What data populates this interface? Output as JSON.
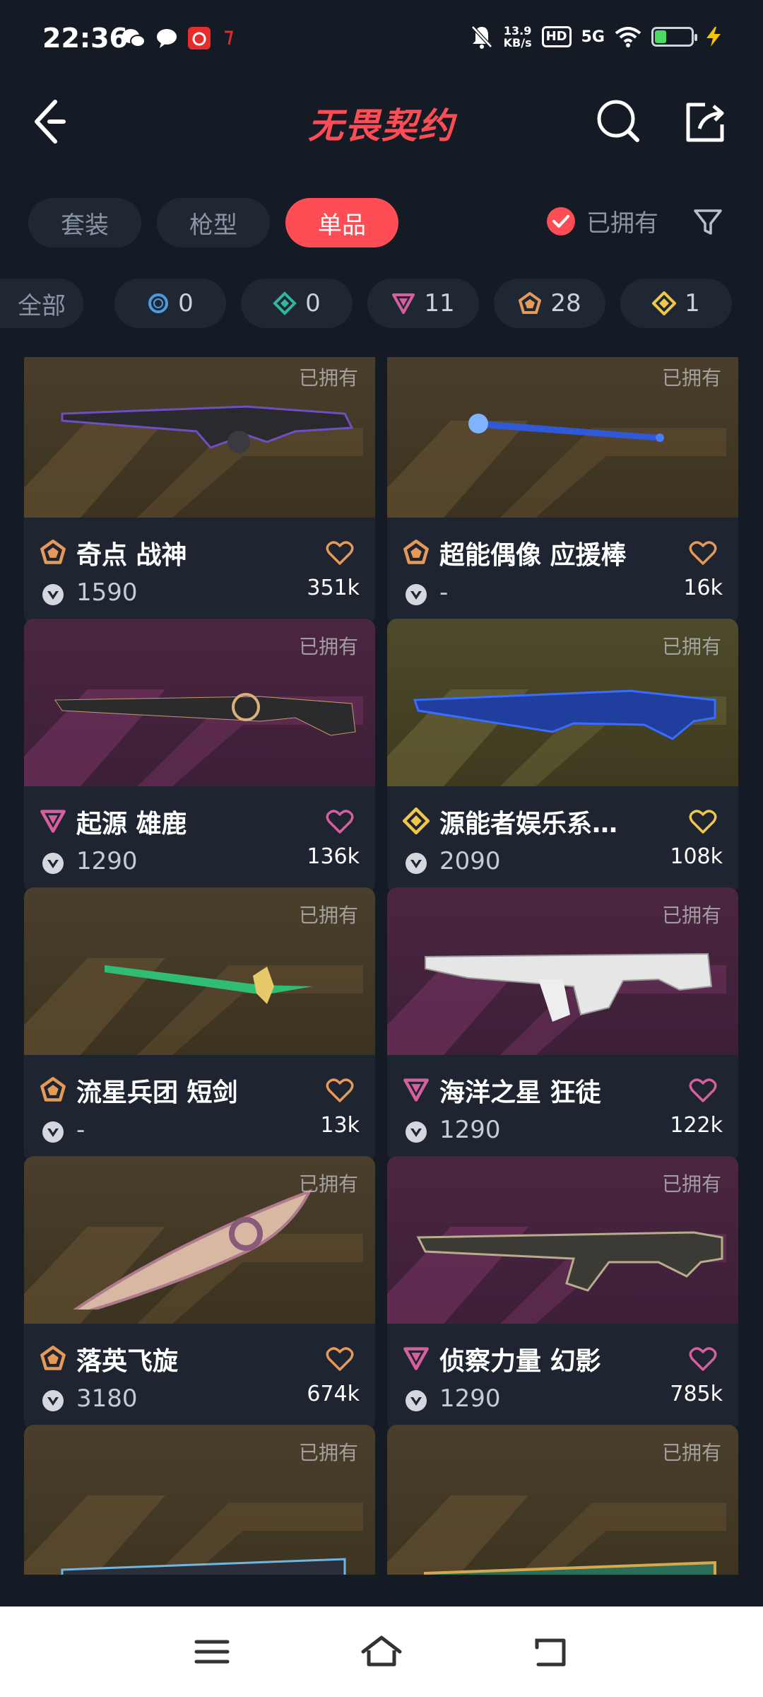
{
  "status_bar": {
    "time": "22:36",
    "net_speed_value": "13.9",
    "net_speed_unit": "KB/s",
    "hd": "HD",
    "network": "5G",
    "battery_level": 0.3
  },
  "header": {
    "logo": "无畏契约"
  },
  "tabs": [
    {
      "label": "套装",
      "active": false
    },
    {
      "label": "枪型",
      "active": false
    },
    {
      "label": "单品",
      "active": true
    }
  ],
  "owned_filter": {
    "label": "已拥有",
    "checked": true
  },
  "chips": [
    {
      "label": "全部",
      "count": ""
    },
    {
      "label": "",
      "count": "0",
      "icon": "select-tier-icon"
    },
    {
      "label": "",
      "count": "0",
      "icon": "deluxe-tier-icon"
    },
    {
      "label": "",
      "count": "11",
      "icon": "premium-tier-icon"
    },
    {
      "label": "",
      "count": "28",
      "icon": "exclusive-tier-icon"
    },
    {
      "label": "",
      "count": "1",
      "icon": "ultra-tier-icon"
    }
  ],
  "items": [
    {
      "name": "奇点 战神",
      "price": "1590",
      "likes": "351k",
      "owned": "已拥有",
      "tier": "exclusive",
      "bg": "gold"
    },
    {
      "name": "超能偶像 应援棒",
      "price": "-",
      "likes": "16k",
      "owned": "已拥有",
      "tier": "exclusive",
      "bg": "gold"
    },
    {
      "name": "起源 雄鹿",
      "price": "1290",
      "likes": "136k",
      "owned": "已拥有",
      "tier": "premium",
      "bg": "purple"
    },
    {
      "name": "源能者娱乐系…",
      "price": "2090",
      "likes": "108k",
      "owned": "已拥有",
      "tier": "ultra",
      "bg": "yellow"
    },
    {
      "name": "流星兵团 短剑",
      "price": "-",
      "likes": "13k",
      "owned": "已拥有",
      "tier": "exclusive",
      "bg": "gold"
    },
    {
      "name": "海洋之星 狂徒",
      "price": "1290",
      "likes": "122k",
      "owned": "已拥有",
      "tier": "premium",
      "bg": "purple"
    },
    {
      "name": "落英飞旋",
      "price": "3180",
      "likes": "674k",
      "owned": "已拥有",
      "tier": "exclusive",
      "bg": "gold"
    },
    {
      "name": "侦察力量 幻影",
      "price": "1290",
      "likes": "785k",
      "owned": "已拥有",
      "tier": "premium",
      "bg": "purple"
    },
    {
      "name": "",
      "price": "",
      "likes": "",
      "owned": "已拥有",
      "tier": "",
      "bg": "gold"
    },
    {
      "name": "",
      "price": "",
      "likes": "",
      "owned": "已拥有",
      "tier": "",
      "bg": "gold"
    }
  ],
  "colors": {
    "accent": "#ff4d55",
    "exclusive": "#e59a5a",
    "premium": "#d65fa0",
    "ultra": "#f0c74a",
    "select": "#4a9be0",
    "deluxe": "#2fb7a0"
  }
}
